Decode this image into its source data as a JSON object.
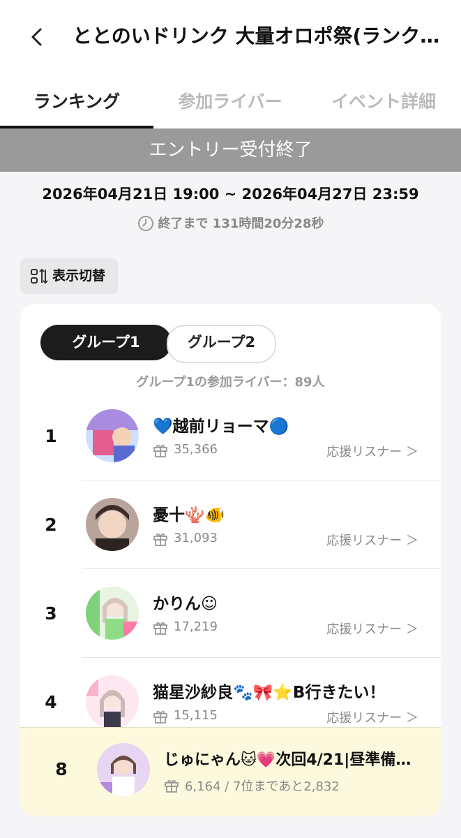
{
  "header": {
    "title": "ととのいドリンク 大量オロポ祭(ランクC..."
  },
  "tabs": [
    {
      "label": "ランキング",
      "active": true
    },
    {
      "label": "参加ライバー",
      "active": false
    },
    {
      "label": "イベント詳細",
      "active": false
    }
  ],
  "banner": "エントリー受付終了",
  "period": "2026年04月21日 19:00 ~ 2026年04月27日 23:59",
  "remaining": "終了まで 131時間20分28秒",
  "toggle_label": "表示切替",
  "groups": [
    {
      "label": "グループ1",
      "active": true
    },
    {
      "label": "グループ2",
      "active": false
    }
  ],
  "participants_text": "グループ1の参加ライバー：89人",
  "listener_label": "応援リスナー ＞",
  "ranking": [
    {
      "rank": "1",
      "name": "💙越前リョーマ🔵",
      "score": "35,366"
    },
    {
      "rank": "2",
      "name": "憂十🪸🐠",
      "score": "31,093"
    },
    {
      "rank": "3",
      "name": "かりん☺",
      "score": "17,219"
    },
    {
      "rank": "4",
      "name": "猫星沙紗良🐾🎀⭐B行きたい！",
      "score": "15,115"
    }
  ],
  "mine": {
    "rank": "8",
    "name": "じゅにゃん🐱💗次回4/21|昼準備…",
    "score": "6,164 / 7位まであと2,832"
  },
  "colors": {
    "banner_bg": "#9a9a9a",
    "highlight_bg": "#fdf9dd",
    "active_pill": "#1c1c1c"
  }
}
